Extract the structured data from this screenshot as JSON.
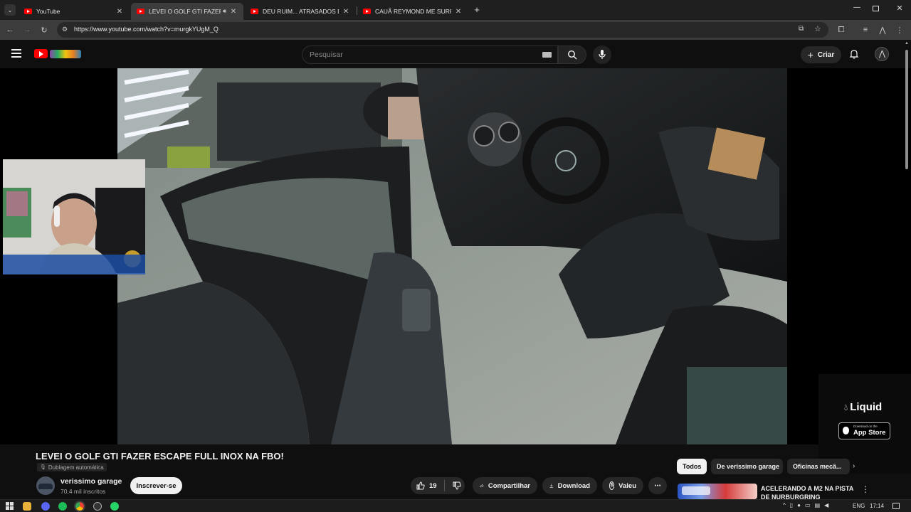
{
  "browser": {
    "tabs": [
      {
        "title": "YouTube",
        "active": false
      },
      {
        "title": "LEVEI O GOLF GTI FAZER ESCAPE",
        "active": true
      },
      {
        "title": "DEU RUIM... ATRASADOS DE PEÇAS",
        "active": false
      },
      {
        "title": "CAUÃ REYMOND ME SURPREENDEU",
        "active": false
      }
    ],
    "new_tab": "+",
    "url": "https://www.youtube.com/watch?v=murgkYUgM_Q"
  },
  "youtube": {
    "search_placeholder": "Pesquisar",
    "create_label": "Criar"
  },
  "ad": {
    "brand": "Liquid",
    "badge_small": "Download on the",
    "badge_big": "App Store"
  },
  "video": {
    "title": "LEVEI O GOLF GTI FAZER ESCAPE FULL INOX NA FBO!",
    "dub_label": "Dublagem automática",
    "channel": "verissimo garage",
    "subscribers": "70,4 mil inscritos",
    "subscribe_label": "Inscrever-se",
    "likes": "19",
    "share_label": "Compartilhar",
    "download_label": "Download",
    "thanks_label": "Valeu",
    "more_label": "⋯"
  },
  "recommendations": {
    "chips": [
      "Todos",
      "De verissimo garage",
      "Oficinas mecâ..."
    ],
    "selected_chip": "Todos",
    "first_title": "ACELERANDO A M2 NA PISTA DE NURBURGRING"
  },
  "taskbar": {
    "lang": "ENG",
    "time": "17:14"
  }
}
